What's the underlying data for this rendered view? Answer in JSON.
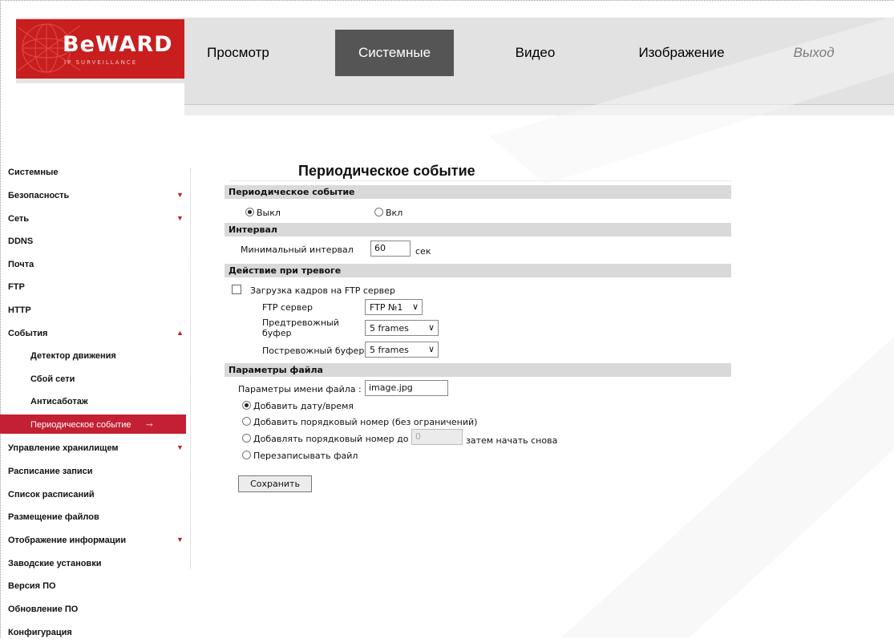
{
  "header": {
    "logo_text": "BeWARD",
    "logo_subtitle": "IP SURVEILLANCE",
    "tabs": [
      {
        "label": "Просмотр"
      },
      {
        "label": "Системные"
      },
      {
        "label": "Видео"
      },
      {
        "label": "Изображение"
      },
      {
        "label": "Выход"
      }
    ],
    "active_tab": "Системные"
  },
  "sidebar": {
    "items": [
      {
        "label": "Системные"
      },
      {
        "label": "Безопасность",
        "arrow": "down"
      },
      {
        "label": "Сеть",
        "arrow": "down"
      },
      {
        "label": "DDNS"
      },
      {
        "label": "Почта"
      },
      {
        "label": "FTP"
      },
      {
        "label": "HTTP"
      },
      {
        "label": "События",
        "arrow": "up"
      },
      {
        "label": "Детектор движения"
      },
      {
        "label": "Сбой сети"
      },
      {
        "label": "Антисаботаж"
      },
      {
        "label": "Периодическое событие",
        "arrow": "right"
      },
      {
        "label": "Управление хранилищем",
        "arrow": "down"
      },
      {
        "label": "Расписание записи"
      },
      {
        "label": "Список расписаний"
      },
      {
        "label": "Размещение файлов"
      },
      {
        "label": "Отображение информации",
        "arrow": "down"
      },
      {
        "label": "Заводские установки"
      },
      {
        "label": "Версия ПО"
      },
      {
        "label": "Обновление ПО"
      },
      {
        "label": "Конфигурация"
      }
    ],
    "active_item": "Периодическое событие"
  },
  "main": {
    "title": "Периодическое событие",
    "section_periodic": {
      "header": "Периодическое событие",
      "off_label": "Выкл",
      "on_label": "Вкл",
      "selected": "Выкл"
    },
    "section_interval": {
      "header": "Интервал",
      "min_interval_label": "Минимальный интервал",
      "min_interval_value": "60",
      "unit": "сек"
    },
    "section_action": {
      "header": "Действие при тревоге",
      "ftp_upload_label": "Загрузка кадров на FTP сервер",
      "ftp_upload_checked": false,
      "ftp_server_label": "FTP сервер",
      "ftp_server_value": "FTP №1",
      "pre_buffer_label_1": "Предтревожный",
      "pre_buffer_label_2": "буфер",
      "pre_buffer_value": "5 frames",
      "post_buffer_label": "Постревожный буфер",
      "post_buffer_value": "5 frames"
    },
    "section_file": {
      "header": "Параметры файла",
      "filename_label": "Параметры имени файла :",
      "filename_value": "image.jpg",
      "opt_datetime": "Добавить дату/время",
      "opt_seq_unlimited": "Добавить порядковый номер (без ограничений)",
      "opt_seq_limit": "Добавлять порядковый номер до",
      "seq_limit_value": "0",
      "opt_seq_limit_suffix": "затем начать снова",
      "opt_overwrite": "Перезаписывать файл",
      "selected": "Добавить дату/время"
    },
    "save_label": "Сохранить"
  },
  "colors": {
    "brand_red": "#c81e1e",
    "active_tab_bg": "#555555",
    "active_sidebar_bg": "#c32033",
    "section_bar_bg": "#d9d9d9",
    "header_bg": "#e2e2e2"
  },
  "icons": [
    "logo-globe-icon",
    "chevron-down-icon",
    "triangle-down-icon",
    "triangle-up-icon",
    "arrow-right-icon"
  ]
}
